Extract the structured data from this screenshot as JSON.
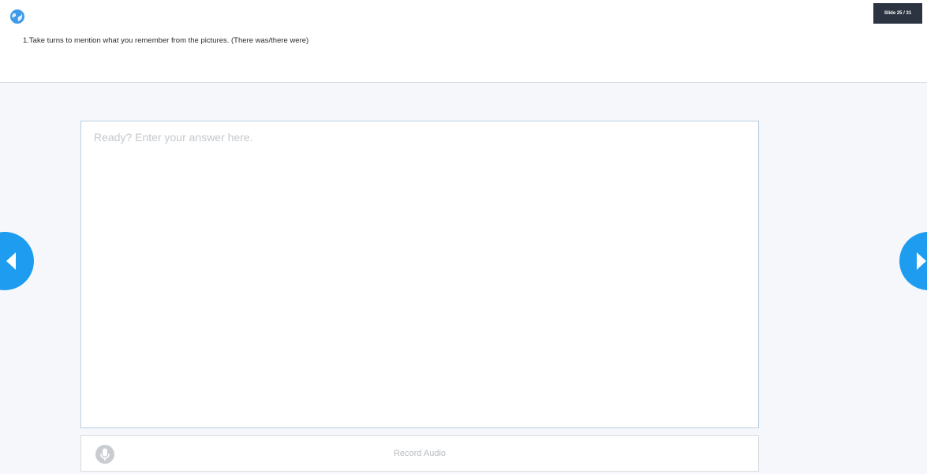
{
  "header": {
    "icon": "globe-icon",
    "instruction": "1.Take turns to mention what you remember from the pictures. (There was/there were)",
    "slide_counter": "Slide 25 / 31"
  },
  "answer": {
    "placeholder": "Ready? Enter your answer here.",
    "value": ""
  },
  "record": {
    "icon": "microphone-icon",
    "label": "Record Audio"
  },
  "navigation": {
    "prev_icon": "chevron-left-icon",
    "next_icon": "chevron-right-icon"
  },
  "colors": {
    "accent": "#1e9cf0",
    "badge_bg": "#2b3440",
    "content_bg": "#f5f7fa",
    "placeholder": "#c4c8cc"
  }
}
